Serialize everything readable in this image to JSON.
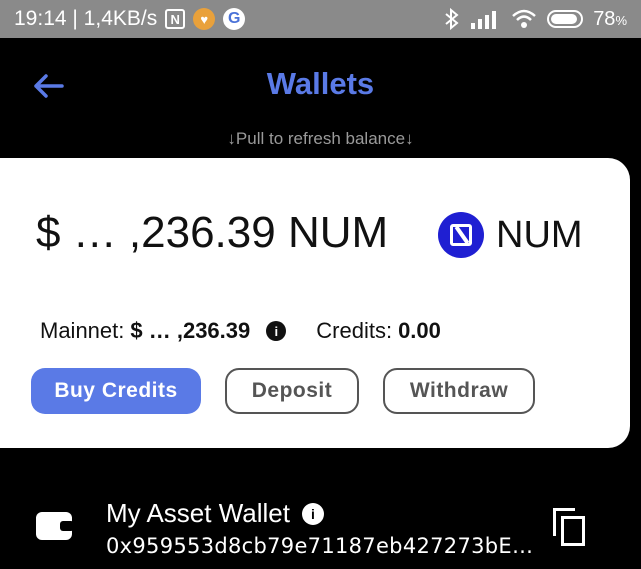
{
  "status_bar": {
    "time_speed": "19:14 | 1,4KB/s",
    "nfc_icon": "N",
    "google_icon": "G",
    "battery_percent": "78",
    "battery_unit": "%"
  },
  "header": {
    "title": "Wallets",
    "back_icon": "arrow-left-icon",
    "refresh_hint": "↓Pull to refresh balance↓"
  },
  "balance_card": {
    "balance": "$ … ,236.39 NUM",
    "token_name": "NUM",
    "mainnet_label": "Mainnet:",
    "mainnet_value": "$ … ,236.39",
    "credits_label": "Credits:",
    "credits_value": "0.00",
    "info_glyph": "i",
    "buttons": {
      "buy": "Buy Credits",
      "deposit": "Deposit",
      "withdraw": "Withdraw"
    }
  },
  "wallet": {
    "name": "My Asset Wallet",
    "address": "0x959553d8cb79e71187eb427273bE…",
    "info_glyph": "i"
  },
  "colors": {
    "accent": "#5a7ae6",
    "token_logo": "#1f1fd2",
    "background": "#000000",
    "card": "#ffffff"
  }
}
